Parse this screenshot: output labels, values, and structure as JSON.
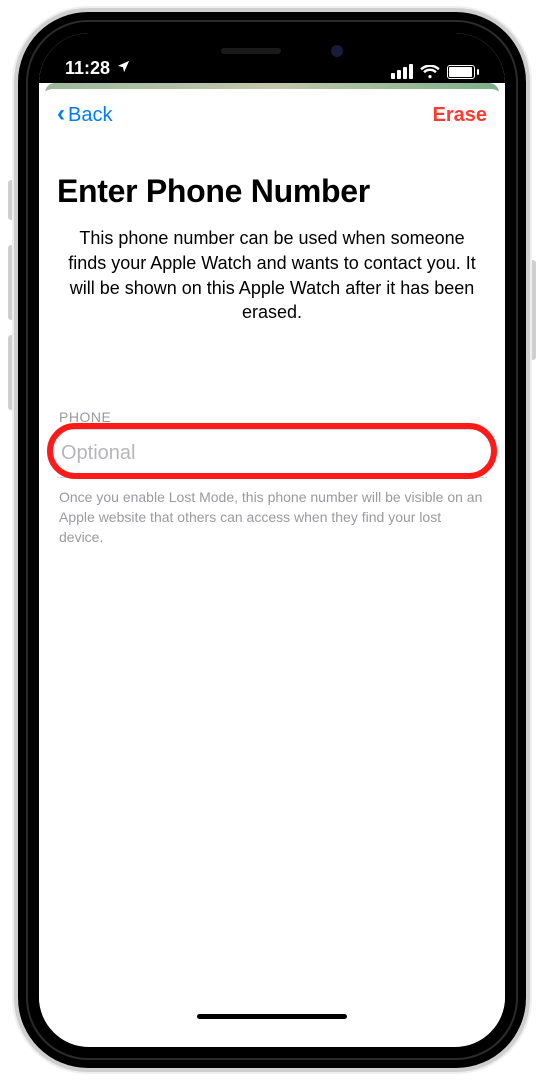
{
  "status": {
    "time": "11:28",
    "location_icon": "location-arrow"
  },
  "nav": {
    "back_label": "Back",
    "action_label": "Erase"
  },
  "header": {
    "title": "Enter Phone Number",
    "description": "This phone number can be used when someone finds your Apple Watch and wants to contact you. It will be shown on this Apple Watch after it has been erased."
  },
  "form": {
    "section_label": "PHONE",
    "phone_placeholder": "Optional",
    "phone_value": "",
    "footer_note": "Once you enable Lost Mode, this phone number will be visible on an Apple website that others can access when they find your lost device."
  },
  "colors": {
    "tint_blue": "#007aff",
    "destructive_red": "#ff3b30",
    "highlight_red": "#ff1a1a"
  },
  "annotation": {
    "highlight_target": "phone-input"
  }
}
